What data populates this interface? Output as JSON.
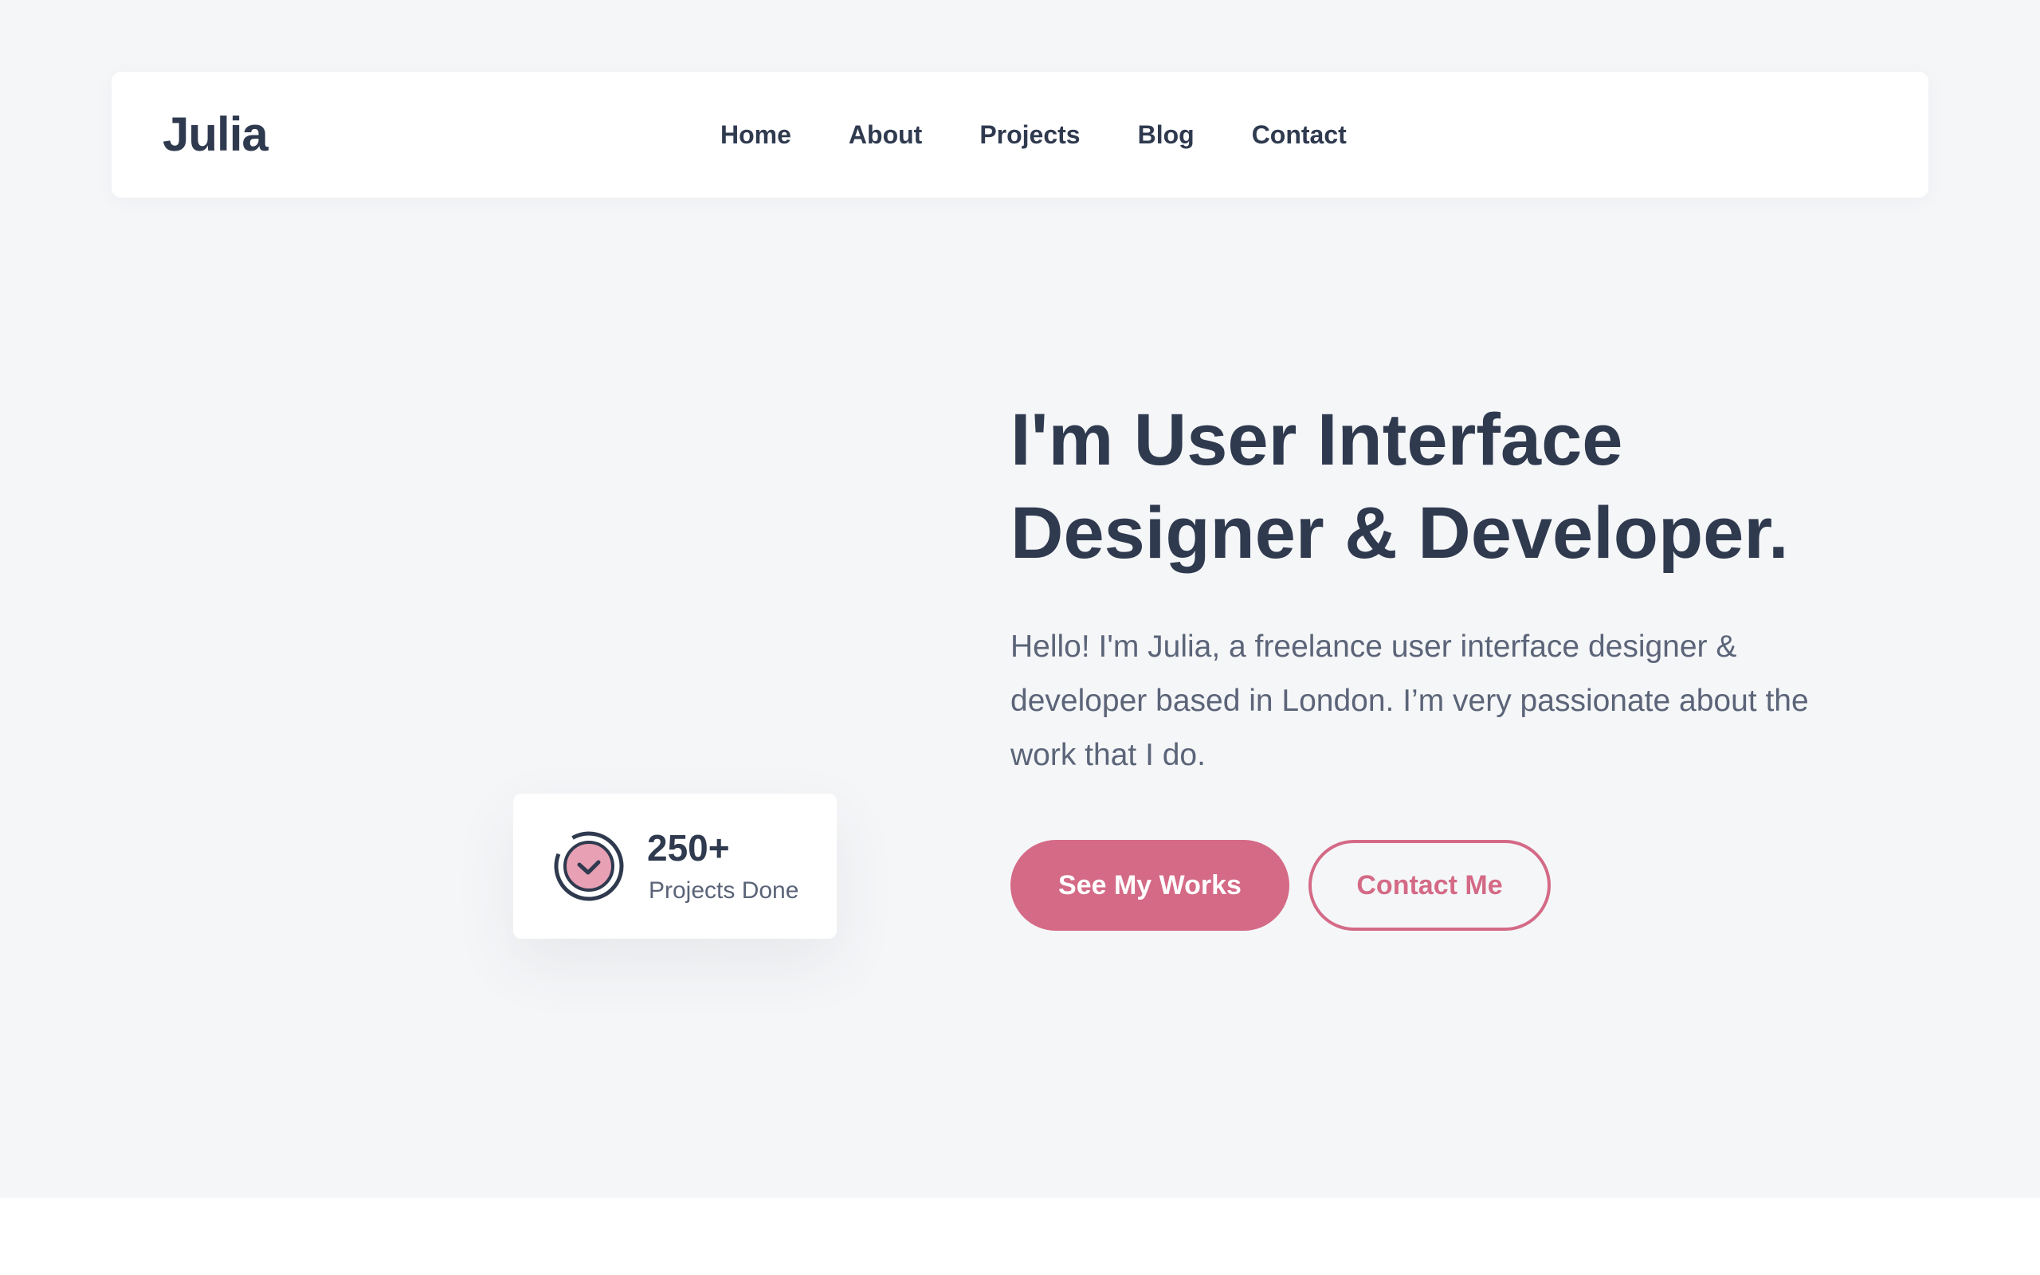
{
  "brand": {
    "logo": "Julia"
  },
  "nav": {
    "items": [
      {
        "label": "Home"
      },
      {
        "label": "About"
      },
      {
        "label": "Projects"
      },
      {
        "label": "Blog"
      },
      {
        "label": "Contact"
      }
    ]
  },
  "hero": {
    "title_line1": "I'm User Interface",
    "title_line2": "Designer & Developer.",
    "description": "Hello! I'm Julia, a freelance user interface designer & developer based in London. I’m very passionate about the work that I do.",
    "primary_button": "See My Works",
    "secondary_button": "Contact Me"
  },
  "stat": {
    "icon": "check-circle-icon",
    "value": "250+",
    "label": "Projects Done"
  },
  "colors": {
    "accent": "#d46a86",
    "text_dark": "#2f3a4f",
    "text_muted": "#5b6478",
    "hero_background": "#f5f6f8",
    "icon_fill": "#e8a0b4"
  }
}
